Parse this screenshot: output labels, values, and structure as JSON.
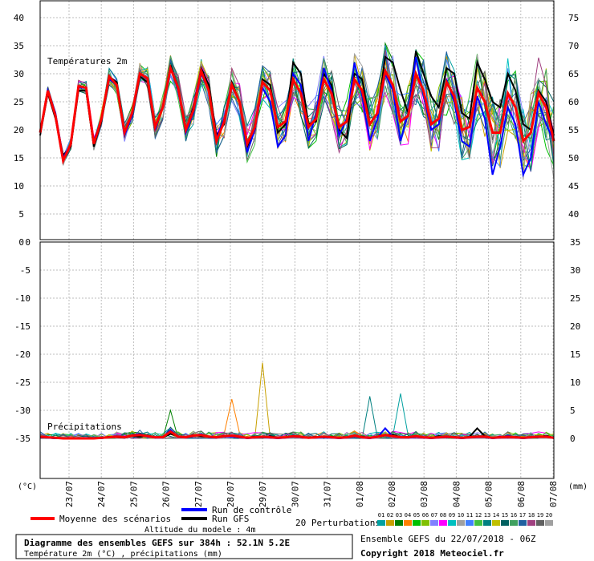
{
  "chart_data": [
    {
      "type": "line",
      "panel": "temperature",
      "title": "Températures 2m",
      "ylim": [
        0,
        40
      ],
      "left_ticks": [
        "0",
        "5",
        "10",
        "15",
        "20",
        "25",
        "30",
        "35",
        "40"
      ],
      "right_ticks": [
        "40",
        "45",
        "50",
        "55",
        "60",
        "65",
        "70",
        "75"
      ],
      "x_labels": [
        "23/07",
        "24/07",
        "25/07",
        "26/07",
        "27/07",
        "28/07",
        "29/07",
        "30/07",
        "31/07",
        "01/08",
        "02/08",
        "03/08",
        "04/08",
        "05/08",
        "06/08",
        "07/08"
      ],
      "grid": true,
      "series": [
        {
          "name": "Moyenne des scénarios",
          "values": [
            19.5,
            27,
            22.5,
            14.5,
            17.5,
            27.8,
            27.5,
            17.5,
            22,
            29.5,
            28,
            19.5,
            23,
            30,
            29.2,
            20.5,
            24,
            31,
            27.5,
            20,
            23.5,
            30.5,
            27,
            18,
            21.5,
            28,
            25,
            17.5,
            20.5,
            28.5,
            27,
            20.5,
            21.5,
            29,
            26.5,
            20.5,
            22,
            29,
            26.5,
            20.5,
            21.5,
            29,
            27,
            21,
            23,
            30.5,
            28,
            21.5,
            22.5,
            30,
            27,
            21,
            22,
            28.5,
            26,
            20,
            20.5,
            27.5,
            25,
            19.5,
            19.5,
            26.5,
            24,
            18,
            19.5,
            26.5,
            24,
            18
          ]
        },
        {
          "name": "Run de contrôle",
          "values": [
            19.5,
            27,
            23,
            15,
            17.5,
            27.5,
            27.5,
            18,
            22,
            29,
            28,
            19,
            22.5,
            30,
            29,
            20,
            24,
            31,
            27,
            19.5,
            23,
            30,
            27,
            18.5,
            22,
            28,
            25,
            16,
            20,
            27.5,
            25,
            17,
            19,
            30,
            28,
            18,
            23,
            31,
            27,
            19,
            22,
            32,
            26,
            18,
            22,
            30,
            27,
            18,
            23,
            33,
            26,
            20,
            21,
            29,
            25,
            18,
            17,
            26,
            22,
            12,
            17,
            24,
            21,
            12,
            15,
            25,
            21,
            18
          ]
        },
        {
          "name": "Run GFS",
          "values": [
            19,
            26.5,
            22,
            15.5,
            17,
            27,
            27,
            17,
            21.5,
            29.5,
            28.5,
            19.5,
            22.5,
            29.5,
            28.5,
            20,
            24,
            31.5,
            27,
            20,
            24,
            31,
            28,
            19,
            21,
            28.5,
            25,
            17,
            20,
            29,
            28,
            19.5,
            21,
            32,
            30,
            21,
            21.5,
            30,
            28,
            20,
            18.5,
            30,
            29,
            21,
            23,
            33,
            32,
            27,
            23,
            34,
            30,
            26,
            24,
            31,
            30,
            23,
            22,
            32,
            29,
            25,
            24,
            30,
            27,
            21,
            20,
            27,
            25,
            19
          ]
        }
      ]
    },
    {
      "type": "line",
      "panel": "precipitation",
      "title": "Précipitations",
      "ylim": [
        0,
        35
      ],
      "left_ticks": [
        "0",
        "-5",
        "-10",
        "-15",
        "-20",
        "-25",
        "-30",
        "-35"
      ],
      "right_ticks": [
        "0",
        "5",
        "10",
        "15",
        "20",
        "25",
        "30",
        "35"
      ],
      "x_labels": [
        "23/07",
        "24/07",
        "25/07",
        "26/07",
        "27/07",
        "28/07",
        "29/07",
        "30/07",
        "31/07",
        "01/08",
        "02/08",
        "03/08",
        "04/08",
        "05/08",
        "06/08",
        "07/08"
      ],
      "grid": true,
      "series": [
        {
          "name": "Moyenne des scénarios",
          "values": [
            0.3,
            0.2,
            0.1,
            0,
            0,
            0,
            0,
            0,
            0.1,
            0.2,
            0.3,
            0.2,
            0.5,
            0.6,
            0.4,
            0.2,
            0.2,
            1.2,
            0.3,
            0.2,
            0.5,
            0.6,
            0.3,
            0.2,
            0.4,
            0.5,
            0.3,
            0.1,
            0.2,
            0.3,
            0.2,
            0.1,
            0.2,
            0.4,
            0.3,
            0.1,
            0.2,
            0.3,
            0.2,
            0.1,
            0.2,
            0.5,
            0.2,
            0.1,
            0.3,
            0.6,
            0.4,
            0.2,
            0.2,
            0.4,
            0.2,
            0.1,
            0.2,
            0.3,
            0.2,
            0.1,
            0.2,
            0.3,
            0.3,
            0.1,
            0.2,
            0.3,
            0.2,
            0.1,
            0.2,
            0.3,
            0.3,
            0.1
          ]
        },
        {
          "name": "Run de contrôle",
          "values": [
            0.2,
            0.1,
            0,
            0,
            0,
            0,
            0,
            0,
            0,
            0.2,
            0.4,
            0.1,
            0.6,
            0.8,
            0.3,
            0.1,
            0.1,
            1.5,
            0.2,
            0.1,
            0.4,
            0.8,
            0.2,
            0.1,
            0.3,
            0.3,
            0.2,
            0,
            0.1,
            0.2,
            0.1,
            0,
            0.1,
            0.3,
            0.2,
            0.1,
            0.1,
            0.2,
            0.1,
            0,
            0.1,
            0.4,
            0.1,
            0,
            0.2,
            1.8,
            0.3,
            0.1,
            0.1,
            0.3,
            0.1,
            0,
            0.1,
            0.2,
            0.1,
            0,
            0.1,
            0.2,
            0.2,
            0,
            0.1,
            0.5,
            0.1,
            0,
            0.1,
            0.2,
            0.4,
            0
          ]
        },
        {
          "name": "Run GFS",
          "values": [
            0.2,
            0.1,
            0,
            0,
            0,
            0,
            0,
            0,
            0.1,
            0.3,
            0.2,
            0.1,
            0.4,
            0.3,
            0.5,
            0.2,
            0.2,
            0.8,
            0.4,
            0.2,
            0.6,
            0.4,
            0.3,
            0.1,
            0.5,
            0.4,
            0.2,
            0.1,
            0.3,
            0.2,
            0.4,
            0.1,
            0.2,
            0.3,
            0.2,
            0.1,
            0.3,
            0.2,
            0.3,
            0.1,
            0.2,
            0.4,
            0.3,
            0.1,
            0.3,
            0.5,
            0.7,
            0.2,
            0.3,
            0.3,
            0.2,
            0.1,
            0.4,
            0.2,
            0.3,
            0.1,
            0.3,
            1.8,
            0.4,
            0.1,
            0.3,
            0.2,
            0.3,
            0.1,
            0.2,
            0.2,
            0.5,
            0.1
          ]
        }
      ]
    }
  ],
  "colors": {
    "mean": "#ff0000",
    "control": "#0000ff",
    "gfs": "#000000",
    "perturbations": [
      "#00a0a0",
      "#c8a000",
      "#008000",
      "#ff8000",
      "#00c000",
      "#80c000",
      "#8080ff",
      "#ff00ff",
      "#00c0c0",
      "#a0a0a0",
      "#4080ff",
      "#40c040",
      "#008080",
      "#c0c000",
      "#006060",
      "#40a060",
      "#2060a0",
      "#a04080",
      "#606060",
      "#a0a0a0"
    ]
  },
  "axis_unit_left": "(°C)",
  "axis_unit_right": "(mm)",
  "legend": {
    "mean": "Moyenne des scénarios",
    "control": "Run de contrôle",
    "gfs": "Run GFS",
    "perturbations_label": "20 Perturbations",
    "perturbation_numbers": [
      "01",
      "02",
      "03",
      "04",
      "05",
      "06",
      "07",
      "08",
      "09",
      "10",
      "11",
      "12",
      "13",
      "14",
      "15",
      "16",
      "17",
      "18",
      "19",
      "20"
    ],
    "altitude": "Altitude du modele : 4m"
  },
  "footer": {
    "box_title": "Diagramme des ensembles GEFS sur 384h : 52.1N 5.2E",
    "box_subtitle": "Température 2m (°C) , précipitations (mm)",
    "run_info": "Ensemble GEFS du 22/07/2018 - 06Z",
    "copyright": "Copyright 2018 Meteociel.fr"
  }
}
